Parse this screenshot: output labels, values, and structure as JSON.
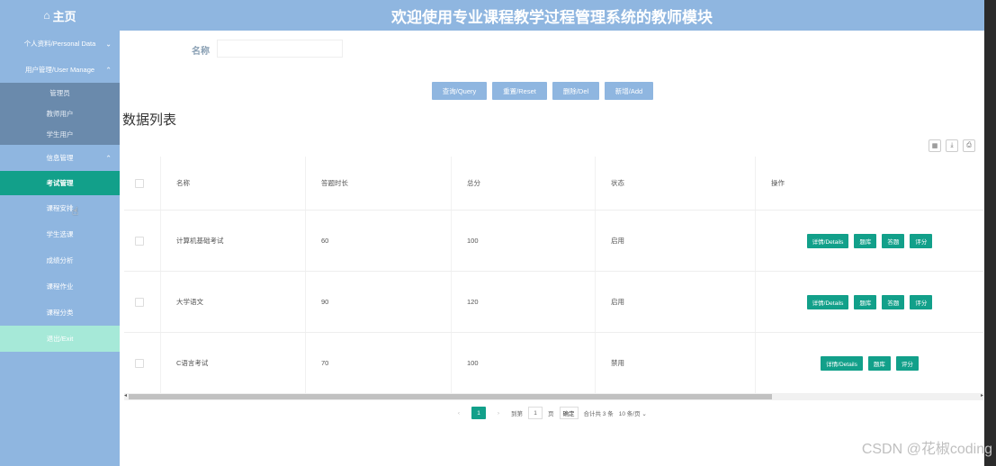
{
  "header": {
    "home_icon": "home-icon",
    "home_label": "主页",
    "title": "欢迎使用专业课程教学过程管理系统的教师模块"
  },
  "sidebar": {
    "personal_data": "个人资料/Personal Data",
    "user_manage": "用户管理/User Manage",
    "user_items": [
      "管理员",
      "教师用户",
      "学生用户"
    ],
    "info_manage": "信息管理",
    "info_items": [
      "考试管理",
      "课程安排",
      "学生选课",
      "成绩分析",
      "课程作业",
      "课程分类"
    ],
    "exit": "退出/Exit"
  },
  "search": {
    "label": "名称",
    "value": ""
  },
  "buttons": {
    "query": "查询/Query",
    "reset": "重置/Reset",
    "delete": "删除/Del",
    "add": "新增/Add"
  },
  "list_title": "数据列表",
  "tools": [
    "grid-icon",
    "download-icon",
    "print-icon"
  ],
  "table": {
    "headers": [
      "名称",
      "答题时长",
      "总分",
      "状态",
      "操作"
    ],
    "rows": [
      {
        "name": "计算机基础考试",
        "duration": "60",
        "score": "100",
        "status": "启用",
        "actions": [
          "详情/Details",
          "题库",
          "答题",
          "评分"
        ]
      },
      {
        "name": "大学语文",
        "duration": "90",
        "score": "120",
        "status": "启用",
        "actions": [
          "详情/Details",
          "题库",
          "答题",
          "评分"
        ]
      },
      {
        "name": "C语言考试",
        "duration": "70",
        "score": "100",
        "status": "禁用",
        "actions": [
          "详情/Details",
          "题库",
          "评分"
        ]
      }
    ]
  },
  "pager": {
    "prev": "‹",
    "page": "1",
    "next": "›",
    "goto_label": "到第",
    "goto_value": "1",
    "page_unit": "页",
    "confirm": "确定",
    "total": "合计共 3 条",
    "page_size": "10 条/页"
  },
  "watermark": "CSDN @花椒coding"
}
